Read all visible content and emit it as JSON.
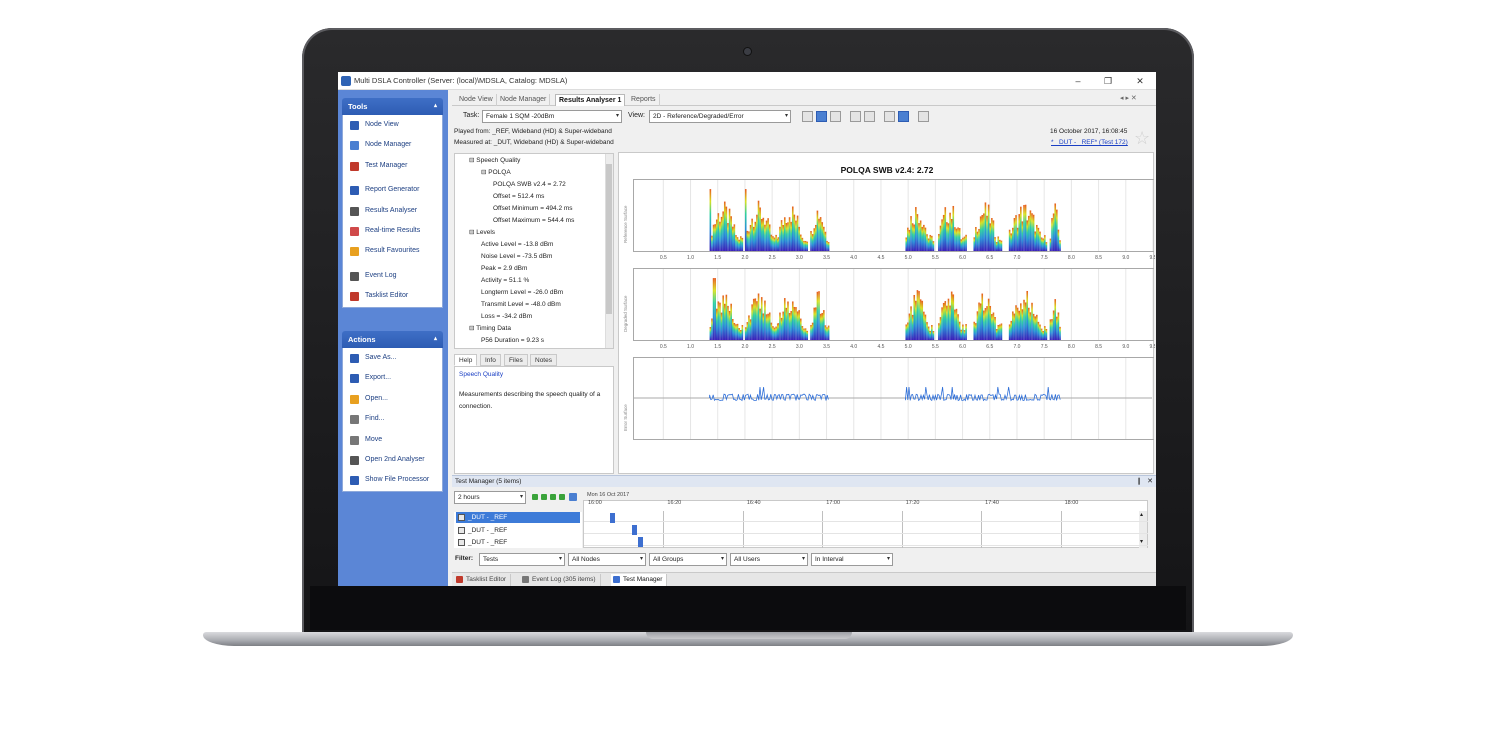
{
  "window": {
    "title": "Multi DSLA Controller (Server: (local)\\MDSLA, Catalog: MDSLA)",
    "min": "–",
    "max": "❐",
    "close": "✕"
  },
  "tools_panel": {
    "title": "Tools",
    "collapse": "▴",
    "items": [
      "Node View",
      "Node Manager",
      "Test Manager",
      "Report Generator",
      "Results Analyser",
      "Real-time Results",
      "Result Favourites",
      "Event Log",
      "Tasklist Editor"
    ]
  },
  "actions_panel": {
    "title": "Actions",
    "collapse": "▴",
    "items": [
      "Save As...",
      "Export...",
      "Open...",
      "Find...",
      "Move",
      "Open 2nd Analyser",
      "Show File Processor"
    ]
  },
  "doc_tabs": [
    "Node View",
    "Node Manager",
    "Results Analyser 1",
    "Reports"
  ],
  "doc_tab_controls": "◂ ▸ ✕",
  "toolbar": {
    "task_label": "Task:",
    "task_value": "Female 1 SQM -20dBm",
    "view_label": "View:",
    "view_value": "2D - Reference/Degraded/Error",
    "dropdown_arrow": "▾"
  },
  "info": {
    "played_from": "Played from: _REF, Wideband (HD) & Super-wideband",
    "measured_at": "Measured at: _DUT, Wideband (HD) & Super-wideband",
    "date": "16 October 2017, 16:08:45",
    "test_link": "* _DUT - _REF* (Test 172)"
  },
  "tree": [
    {
      "text": "⊟ Speech Quality",
      "indent": 0
    },
    {
      "text": "⊟ POLQA",
      "indent": 1
    },
    {
      "text": "POLQA SWB v2.4 = 2.72",
      "indent": 2
    },
    {
      "text": "Offset = 512.4 ms",
      "indent": 2
    },
    {
      "text": "Offset Minimum = 494.2 ms",
      "indent": 2
    },
    {
      "text": "Offset Maximum = 544.4 ms",
      "indent": 2
    },
    {
      "text": "⊟ Levels",
      "indent": 0
    },
    {
      "text": "Active Level = -13.8 dBm",
      "indent": 1
    },
    {
      "text": "Noise Level = -73.5 dBm",
      "indent": 1
    },
    {
      "text": "Peak = 2.9 dBm",
      "indent": 1
    },
    {
      "text": "Activity = 51.1 %",
      "indent": 1
    },
    {
      "text": "Longterm Level = -26.0 dBm",
      "indent": 1
    },
    {
      "text": "Transmit Level = -48.0 dBm",
      "indent": 1
    },
    {
      "text": "Loss = -34.2 dBm",
      "indent": 1
    },
    {
      "text": "⊟ Timing Data",
      "indent": 0
    },
    {
      "text": "P56 Duration = 9.23 s",
      "indent": 1
    }
  ],
  "help_tabs": [
    "Help",
    "Info",
    "Files",
    "Notes"
  ],
  "help": {
    "title": "Speech Quality",
    "body": "Measurements describing the speech quality of a connection."
  },
  "chart": {
    "title": "POLQA SWB v2.4: 2.72",
    "panels": [
      "Reference Surface",
      "Degraded Surface",
      "Error Surface"
    ],
    "ticks": [
      "0.5",
      "1.0",
      "1.5",
      "2.0",
      "2.5",
      "3.0",
      "3.5",
      "4.0",
      "4.5",
      "5.0",
      "5.5",
      "6.0",
      "6.5",
      "7.0",
      "7.5",
      "8.0",
      "8.5",
      "9.0",
      "9.5"
    ]
  },
  "chart_data": {
    "type": "bar",
    "title": "POLQA SWB v2.4: 2.72",
    "x_ticks": [
      0.5,
      1.0,
      1.5,
      2.0,
      2.5,
      3.0,
      3.5,
      4.0,
      4.5,
      5.0,
      5.5,
      6.0,
      6.5,
      7.0,
      7.5,
      8.0,
      8.5,
      9.0,
      9.5
    ],
    "xlim": [
      0.2,
      9.5
    ],
    "series": [
      {
        "name": "Reference Surface",
        "speech_segments": [
          [
            1.35,
            1.95
          ],
          [
            2.0,
            2.6
          ],
          [
            2.6,
            3.15
          ],
          [
            3.2,
            3.55
          ],
          [
            4.95,
            5.45
          ],
          [
            5.55,
            6.05
          ],
          [
            6.2,
            6.7
          ],
          [
            6.85,
            7.55
          ],
          [
            7.6,
            7.8
          ]
        ]
      },
      {
        "name": "Degraded Surface",
        "speech_segments": [
          [
            1.35,
            1.95
          ],
          [
            2.0,
            2.6
          ],
          [
            2.6,
            3.15
          ],
          [
            3.2,
            3.55
          ],
          [
            4.95,
            5.45
          ],
          [
            5.55,
            6.05
          ],
          [
            6.2,
            6.7
          ],
          [
            6.85,
            7.55
          ],
          [
            7.6,
            7.8
          ]
        ]
      },
      {
        "name": "Error Surface",
        "speech_segments": [
          [
            1.35,
            3.55
          ],
          [
            4.95,
            7.8
          ]
        ]
      }
    ],
    "grid": true,
    "legend": "none"
  },
  "test_manager": {
    "title": "Test Manager (5 items)",
    "pin": "❙",
    "close": "✕",
    "range": "2 hours",
    "date": "Mon 16 Oct 2017",
    "times": [
      "16:00",
      "16:20",
      "16:40",
      "17:00",
      "17:20",
      "17:40",
      "18:00"
    ],
    "rows": [
      "_DUT - _REF",
      "_DUT - _REF",
      "_DUT - _REF"
    ],
    "scroll_up": "▴",
    "scroll_down": "▾"
  },
  "filter": {
    "label": "Filter:",
    "values": [
      "Tests",
      "All Nodes",
      "All Groups",
      "All Users",
      "In Interval"
    ]
  },
  "bottom_tabs": [
    "Tasklist Editor",
    "Event Log (305 items)",
    "Test Manager"
  ],
  "star_icon": "☆",
  "colors": {
    "nav_blue": "#5b86d6",
    "accent": "#2d5cb3",
    "link": "#1a3fc4",
    "selected_row": "#3d7bd8"
  }
}
